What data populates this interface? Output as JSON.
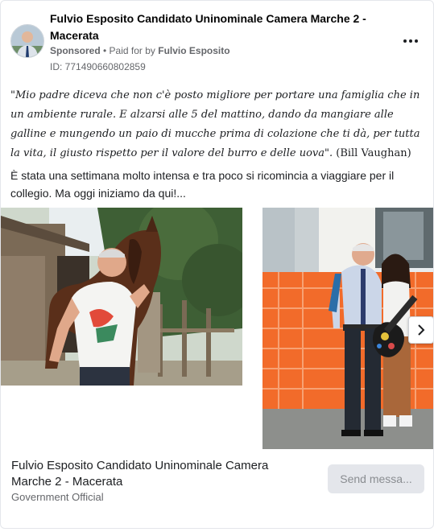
{
  "post": {
    "page_name": "Fulvio Esposito Candidato Uninominale Camera Marche 2 - Macerata",
    "sponsored_label": "Sponsored",
    "paid_for_prefix": " • Paid for by ",
    "paid_for_name": "Fulvio Esposito",
    "ad_id": "ID: 771490660802859",
    "quote": "\"Mio padre diceva che non c'è posto migliore per portare una famiglia che in un ambiente rurale. E alzarsi alle 5 del mattino, dando da mangiare alle galline e mungendo un paio di mucche prima di colazione che ti dà, per tutta la vita, il giusto rispetto per il valore del burro e delle uova\".",
    "quote_author": " (Bill Vaughan)",
    "body": "È stata una settimana molto intensa e tra poco si ricomincia a viaggiare per il collegio. Ma oggi iniziamo da qui!..."
  },
  "icons": {
    "more": "more-options-icon",
    "next": "chevron-right-icon"
  },
  "footer": {
    "title": "Fulvio Esposito Candidato Uninominale Camera Marche 2 - Macerata",
    "category": "Government Official",
    "button_label": "Send messa..."
  },
  "colors": {
    "meta_text": "#65676b",
    "button_bg": "#e4e6eb",
    "fence_orange": "#f26b2a"
  }
}
